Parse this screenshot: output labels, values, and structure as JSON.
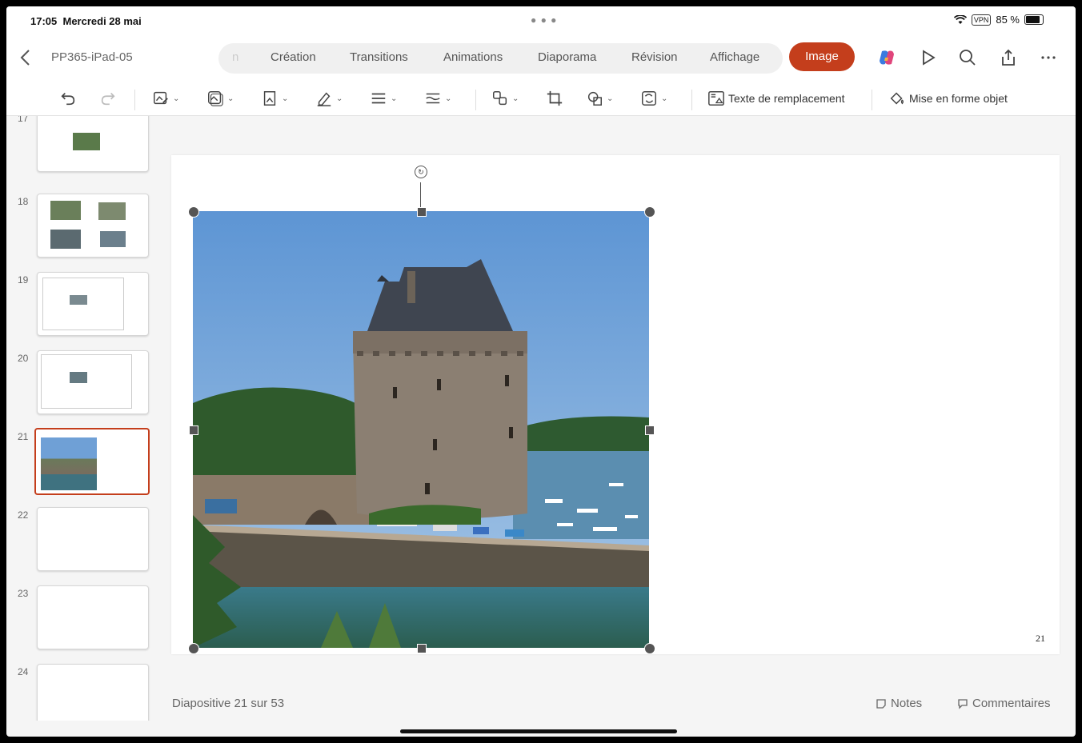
{
  "status_bar": {
    "time": "17:05",
    "date": "Mercredi 28 mai",
    "vpn": "VPN",
    "battery": "85 %"
  },
  "document": {
    "title": "PP365-iPad-05"
  },
  "tabs": {
    "partial": "n",
    "items": [
      "Création",
      "Transitions",
      "Animations",
      "Diaporama",
      "Révision",
      "Affichage"
    ],
    "active": "Image"
  },
  "toolbar": {
    "alt_text_label": "Texte de remplacement",
    "format_object_label": "Mise en forme  objet"
  },
  "thumbnails": [
    {
      "number": "17"
    },
    {
      "number": "18"
    },
    {
      "number": "19"
    },
    {
      "number": "20"
    },
    {
      "number": "21",
      "selected": true
    },
    {
      "number": "22"
    },
    {
      "number": "23"
    },
    {
      "number": "24"
    }
  ],
  "slide": {
    "page_number": "21"
  },
  "footer": {
    "slide_count": "Diapositive 21 sur 53",
    "notes": "Notes",
    "comments": "Commentaires"
  },
  "colors": {
    "accent": "#c43e1c"
  }
}
